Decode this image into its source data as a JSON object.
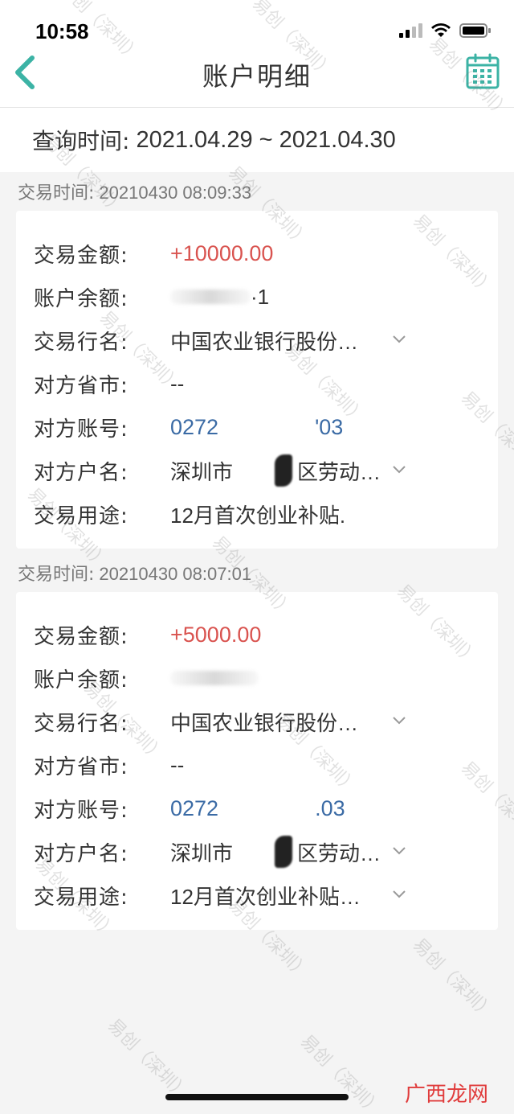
{
  "status_bar": {
    "time": "10:58"
  },
  "nav": {
    "title": "账户明细",
    "back_icon": "chevron-left-icon",
    "calendar_icon": "calendar-icon"
  },
  "query": {
    "label": "查询时间:",
    "value": "2021.04.29 ~ 2021.04.30"
  },
  "transactions": [
    {
      "time_label": "交易时间:",
      "time": "20210430 08:09:33",
      "amount_label": "交易金额:",
      "amount": "+10000.00",
      "balance_label": "账户余额:",
      "balance_visible": "·1",
      "bank_label": "交易行名:",
      "bank": "中国农业银行股份…",
      "province_label": "对方省市:",
      "province": "--",
      "account_label": "对方账号:",
      "account_start": "0272",
      "account_end": "'03",
      "name_label": "对方户名:",
      "name_start": "深圳市",
      "name_end": "区劳动…",
      "purpose_label": "交易用途:",
      "purpose": "12月首次创业补贴."
    },
    {
      "time_label": "交易时间:",
      "time": "20210430 08:07:01",
      "amount_label": "交易金额:",
      "amount": "+5000.00",
      "balance_label": "账户余额:",
      "balance_visible": "",
      "bank_label": "交易行名:",
      "bank": "中国农业银行股份…",
      "province_label": "对方省市:",
      "province": "--",
      "account_label": "对方账号:",
      "account_start": "0272",
      "account_end": ".03",
      "name_label": "对方户名:",
      "name_start": "深圳市",
      "name_end": "区劳动…",
      "purpose_label": "交易用途:",
      "purpose": "12月首次创业补贴…"
    }
  ],
  "watermark": "易创（深圳）",
  "corner_logo": "广西龙网",
  "colors": {
    "accent": "#3cb3a5",
    "amount": "#d9534f",
    "account": "#3b6ba5"
  }
}
